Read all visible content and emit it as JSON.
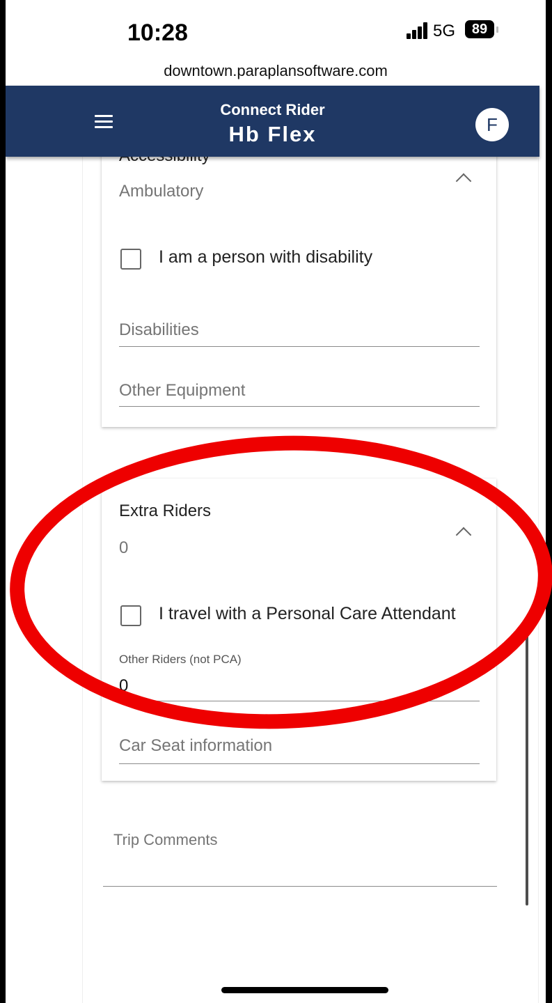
{
  "status_bar": {
    "time": "10:28",
    "network": "5G",
    "battery": "89"
  },
  "browser": {
    "url": "downtown.paraplansoftware.com"
  },
  "app_bar": {
    "subtitle": "Connect Rider",
    "title": "Hb Flex",
    "avatar_initial": "F"
  },
  "accessibility": {
    "title": "Accessibility",
    "value": "Ambulatory",
    "disability_checkbox_label": "I am a person with disability",
    "disabilities_placeholder": "Disabilities",
    "other_equipment_placeholder": "Other Equipment"
  },
  "extra_riders": {
    "title": "Extra Riders",
    "value": "0",
    "pca_checkbox_label": "I travel with a Personal Care Attendant",
    "other_riders_label": "Other Riders (not PCA)",
    "other_riders_value": "0",
    "car_seat_placeholder": "Car Seat information"
  },
  "trip_comments": {
    "label": "Trip Comments"
  },
  "colors": {
    "app_bar": "#1f3864",
    "annotation": "#ee0000"
  },
  "icons": {
    "menu": "hamburger-menu-icon",
    "collapse": "chevron-up-icon"
  }
}
